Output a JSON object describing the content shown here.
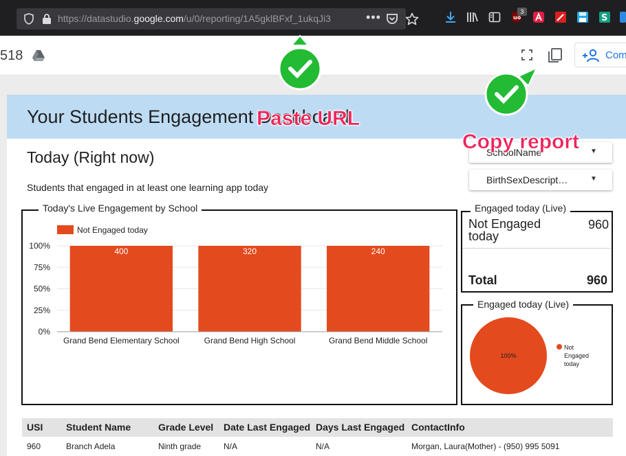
{
  "browser": {
    "url_prefix": "https://datastudio.",
    "url_domain": "google.com",
    "url_path": "/u/0/reporting/1A5gklBFxf_1ukqJi3",
    "more_glyph": "•••",
    "badge_count": "3"
  },
  "header": {
    "report_number": "518",
    "share_label": "Com"
  },
  "report": {
    "title": "Your Students Engagement Dashboard",
    "today_heading": "Today (Right now)",
    "subtitle": "Students that engaged in at least one learning app today",
    "filters": [
      {
        "label": "SchoolName"
      },
      {
        "label": "BirthSexDescript…"
      }
    ]
  },
  "chart_data": [
    {
      "type": "bar",
      "title": "Today's Live Engagement by School",
      "categories": [
        "Grand Bend Elementary School",
        "Grand Bend High School",
        "Grand Bend Middle School"
      ],
      "series": [
        {
          "name": "Not Engaged today",
          "values": [
            400,
            320,
            240
          ],
          "color": "#e34a1d"
        }
      ],
      "stacked_percent": true,
      "yticks": [
        "100%",
        "75%",
        "50%",
        "25%",
        "0%"
      ],
      "ylim": [
        0,
        100
      ],
      "legend": "top-left"
    },
    {
      "type": "pie",
      "title": "Engaged today (Live)",
      "slices": [
        {
          "name": "Not Engaged today",
          "value": 100,
          "label": "100%",
          "color": "#e34a1d"
        }
      ],
      "legend": "right"
    }
  ],
  "scorecard": {
    "title": "Engaged today (Live)",
    "row_label": "Not Engaged today",
    "row_value": "960",
    "total_label": "Total",
    "total_value": "960"
  },
  "students": {
    "columns": [
      "USI",
      "Student Name",
      "Grade Level",
      "Date Last Engaged",
      "Days Last Engaged",
      "ContactInfo"
    ],
    "rows": [
      [
        "960",
        "Branch Adela",
        "Ninth grade",
        "N/A",
        "N/A",
        "Morgan, Laura(Mother) - (950) 995 5091"
      ]
    ]
  },
  "annotations": {
    "paste_url": "Paste URL",
    "copy_report": "Copy report",
    "check_color": "#22bb33"
  }
}
